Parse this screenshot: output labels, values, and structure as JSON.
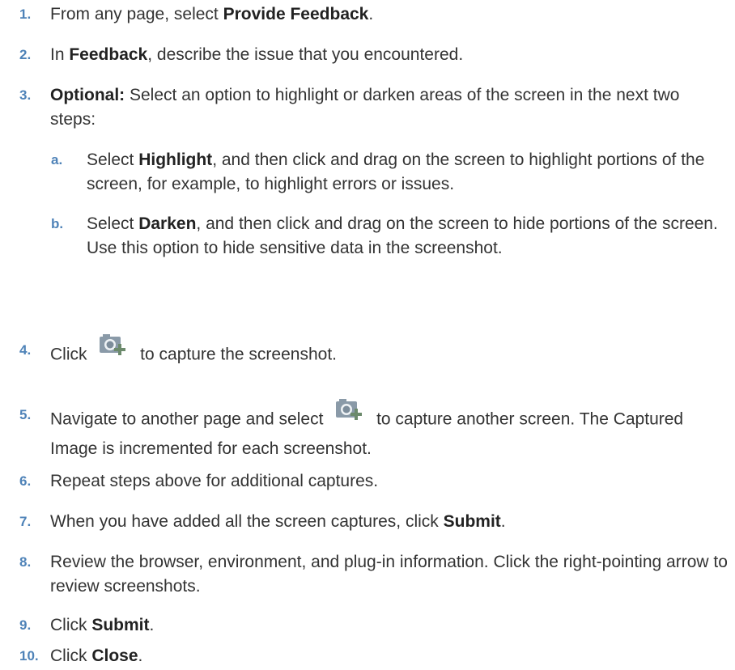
{
  "steps": [
    {
      "num": "1.",
      "parts": [
        "From any page, select ",
        "Provide Feedback",
        "."
      ]
    },
    {
      "num": "2.",
      "parts": [
        "In ",
        "Feedback",
        ", describe the issue that you encountered."
      ]
    },
    {
      "num": "3.",
      "parts": [
        "Optional:",
        " Select an option to highlight or darken areas of the screen in the next two steps:"
      ]
    },
    {
      "num": "4.",
      "parts": [
        "Click ",
        " to capture the screenshot."
      ]
    },
    {
      "num": "5.",
      "parts": [
        "Navigate to another page and select ",
        " to capture another screen. The Captured Image is incremented for each screenshot."
      ]
    },
    {
      "num": "6.",
      "parts": [
        "Repeat steps above for additional captures."
      ]
    },
    {
      "num": "7.",
      "parts": [
        "When you have added all the screen captures, click ",
        "Submit",
        "."
      ]
    },
    {
      "num": "8.",
      "parts": [
        "Review the browser, environment, and plug-in information. Click the right-pointing arrow to review screenshots."
      ]
    },
    {
      "num": "9.",
      "parts": [
        "Click ",
        "Submit",
        "."
      ]
    },
    {
      "num": "10.",
      "parts": [
        "Click ",
        "Close",
        "."
      ]
    }
  ],
  "substeps": [
    {
      "num": "a.",
      "parts": [
        "Select ",
        "Highlight",
        ", and then click and drag on the screen to highlight portions of the screen, for example, to highlight errors or issues."
      ]
    },
    {
      "num": "b.",
      "parts": [
        "Select ",
        "Darken",
        ", and then click and drag on the screen to hide portions of the screen. Use this option to hide sensitive data in the screenshot."
      ]
    }
  ],
  "icons": {
    "capture": "camera-plus-icon"
  }
}
